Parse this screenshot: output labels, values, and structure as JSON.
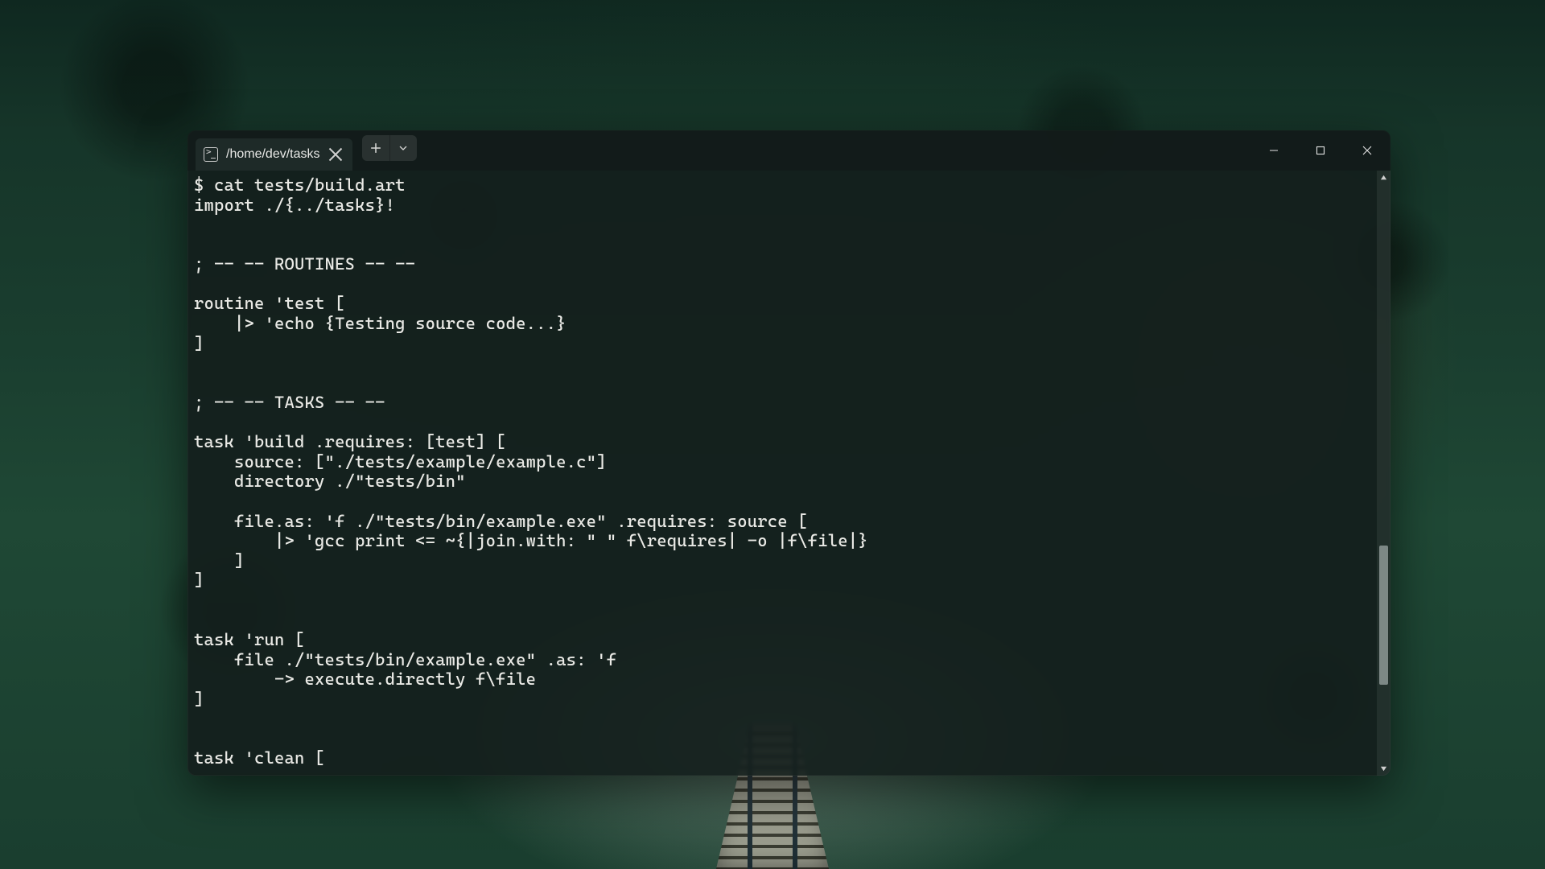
{
  "tab": {
    "title": "/home/dev/tasks"
  },
  "terminal": {
    "lines": [
      "$ cat tests/build.art",
      "import ./{../tasks}!",
      "",
      "",
      "; -- -- ROUTINES -- --",
      "",
      "routine 'test [",
      "    |> 'echo {Testing source code...}",
      "]",
      "",
      "",
      "; -- -- TASKS -- --",
      "",
      "task 'build .requires: [test] [",
      "    source: [\"./tests/example/example.c\"]",
      "    directory ./\"tests/bin\"",
      "",
      "    file.as: 'f ./\"tests/bin/example.exe\" .requires: source [",
      "        |> 'gcc print <= ~{|join.with: \" \" f\\requires| -o |f\\file|}",
      "    ]",
      "]",
      "",
      "",
      "task 'run [",
      "    file ./\"tests/bin/example.exe\" .as: 'f",
      "        -> execute.directly f\\file",
      "]",
      "",
      "",
      "task 'clean ["
    ]
  }
}
